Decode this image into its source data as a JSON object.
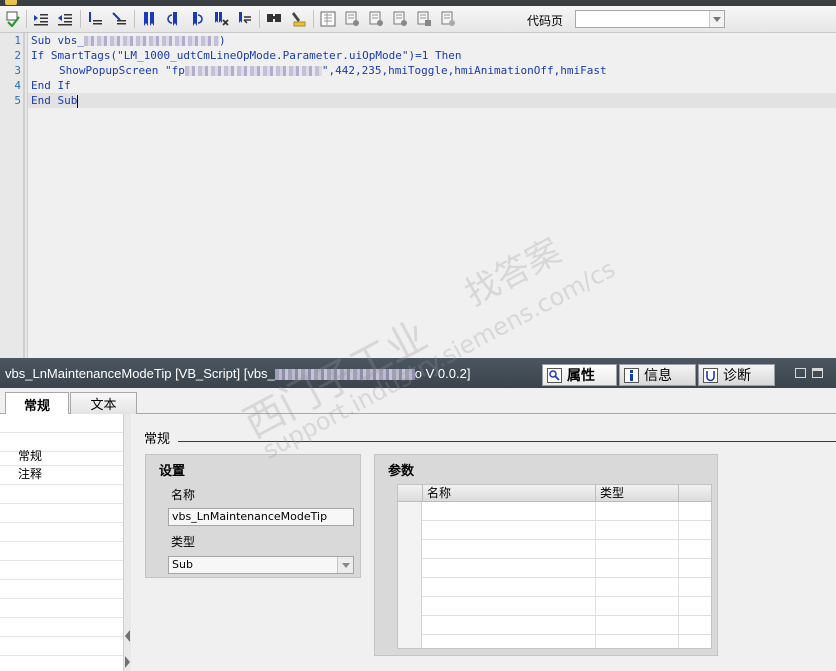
{
  "toolbar": {
    "code_page_label": "代码页",
    "code_page_value": "",
    "icons": [
      "check-icon",
      "indent-icon",
      "outdent-icon",
      "comment-icon",
      "uncomment-icon",
      "bookmark-icon",
      "prev-bookmark-icon",
      "next-bookmark-icon",
      "clear-bookmarks-icon",
      "goto-icon",
      "find-icon",
      "highlight-icon",
      "snippet-1-icon",
      "snippet-2-icon",
      "snippet-3-icon",
      "snippet-4-icon",
      "snippet-5-icon",
      "snippet-6-icon"
    ]
  },
  "editor": {
    "line_numbers": [
      "1",
      "2",
      "3",
      "4",
      "5"
    ],
    "lines": [
      {
        "a": "Sub",
        "b": " vbs_",
        "c": ")"
      },
      {
        "a": "If",
        "b": " SmartTags(",
        "c": "\"LM_1000_udtCmLineOpMode.Parameter.uiOpMode\"",
        "d": ")=1 ",
        "e": "Then"
      },
      {
        "a": "ShowPopupScreen ",
        "b": "\"fp",
        "c": "\",442,235,hmiToggle,hmiAnimationOff,hmiFast"
      },
      {
        "a": "End",
        "b": " If"
      },
      {
        "a": "End",
        "b": " Sub"
      }
    ]
  },
  "inspector": {
    "title_start": "vbs_LnMaintenanceModeTip [VB_Script] [vbs_",
    "title_mid": "o",
    "title_end": " V 0.0.2]",
    "tabs": {
      "properties": "属性",
      "info": "信息",
      "diagnostics": "诊断"
    }
  },
  "subtabs": {
    "general": "常规",
    "text": "文本"
  },
  "nav": {
    "items": [
      "常规",
      "注释"
    ]
  },
  "main": {
    "section_title": "常规",
    "settings": {
      "title": "设置",
      "name_label": "名称",
      "name_value": "vbs_LnMaintenanceModeTip",
      "type_label": "类型",
      "type_value": "Sub"
    },
    "params": {
      "title": "参数",
      "col_name": "名称",
      "col_type": "类型"
    }
  },
  "watermark": {
    "line1": "找答案",
    "line2": "support.industry.siemens.com/cs",
    "line3": "西门子工业"
  }
}
